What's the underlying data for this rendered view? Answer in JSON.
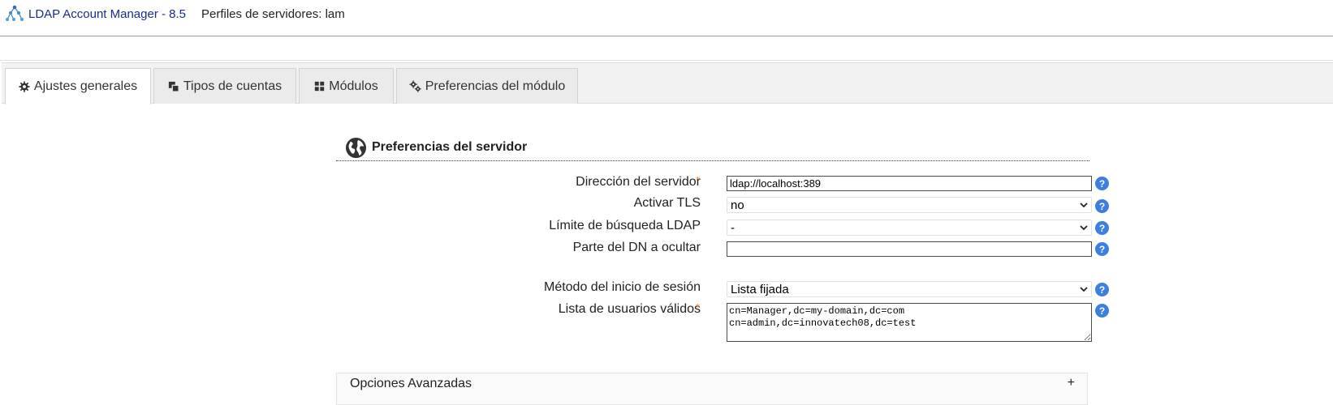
{
  "header": {
    "app_title": "LDAP Account Manager - 8.5",
    "profile_title": "Perfiles de servidores: lam"
  },
  "tabs": [
    {
      "label": "Ajustes generales",
      "icon": "gear-icon",
      "active": true
    },
    {
      "label": "Tipos de cuentas",
      "icon": "stacked-squares-icon",
      "active": false
    },
    {
      "label": "Módulos",
      "icon": "grid-icon",
      "active": false
    },
    {
      "label": "Preferencias del módulo",
      "icon": "gears-icon",
      "active": false
    }
  ],
  "section": {
    "title": "Preferencias del servidor",
    "icon": "globe-icon"
  },
  "form": {
    "server_address": {
      "label": "Dirección del servidor",
      "required_mark": "*",
      "value": "ldap://localhost:389"
    },
    "tls": {
      "label": "Activar TLS",
      "value": "no"
    },
    "search_limit": {
      "label": "Límite de búsqueda LDAP",
      "value": "-"
    },
    "dn_hide": {
      "label": "Parte del DN a ocultar",
      "value": ""
    },
    "login_method": {
      "label": "Método del inicio de sesión",
      "value": "Lista fijada"
    },
    "valid_users": {
      "label": "Lista de usuarios válidos",
      "required_mark": "*",
      "value": "cn=Manager,dc=my-domain,dc=com\ncn=admin,dc=innovatech08,dc=test"
    },
    "help_label": "?"
  },
  "advanced": {
    "label": "Opciones Avanzadas",
    "toggle": "+"
  },
  "colors": {
    "accent_blue": "#3c7fe0",
    "title_blue": "#1a2c8c",
    "required_orange": "#f07f1f"
  }
}
